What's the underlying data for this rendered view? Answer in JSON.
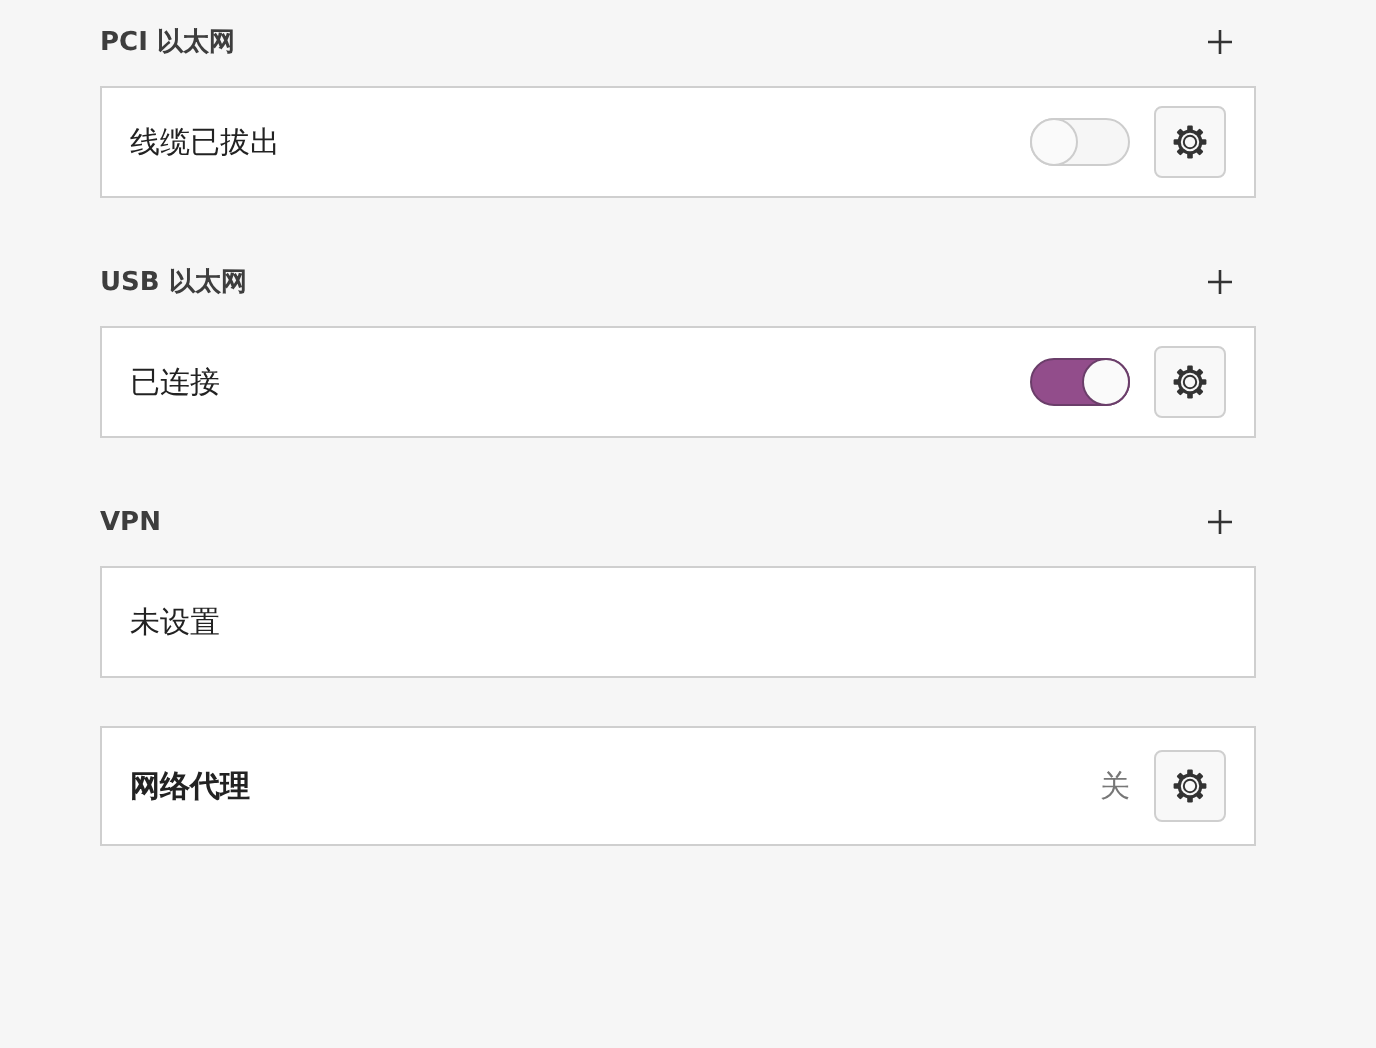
{
  "sections": [
    {
      "title": "PCI 以太网",
      "rows": [
        {
          "kind": "toggle",
          "label": "线缆已拔出",
          "on": false
        }
      ]
    },
    {
      "title": "USB 以太网",
      "rows": [
        {
          "kind": "toggle",
          "label": "已连接",
          "on": true
        }
      ]
    },
    {
      "title": "VPN",
      "rows": [
        {
          "kind": "plain",
          "label": "未设置"
        }
      ]
    }
  ],
  "proxy": {
    "label": "网络代理",
    "status": "关"
  }
}
